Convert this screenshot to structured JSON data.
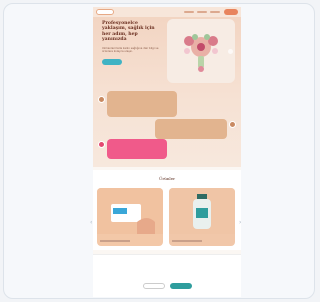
{
  "hero": {
    "title": "Profesyonelce yaklaşım, sağlık için her adım, hep yanınızda",
    "description": "Uzmanlarımızla kadın sağlığına dair bilgi ve ürünlere kolayca ulaşın.",
    "cta_label": ""
  },
  "nav": {
    "logo_text": "",
    "button_label": ""
  },
  "testimonials": [
    {
      "text": ""
    },
    {
      "text": ""
    },
    {
      "text": ""
    }
  ],
  "products": {
    "heading": "Ürünler",
    "items": [
      {
        "name": "",
        "subtitle": ""
      },
      {
        "name": "",
        "subtitle": ""
      }
    ]
  },
  "cookie": {
    "title": "",
    "text": "",
    "settings_label": "",
    "accept_label": ""
  },
  "colors": {
    "accent": "#e8845d",
    "teal": "#3fb3c4",
    "pink": "#f05a8a",
    "hero_bg": "#f2d3c0"
  }
}
